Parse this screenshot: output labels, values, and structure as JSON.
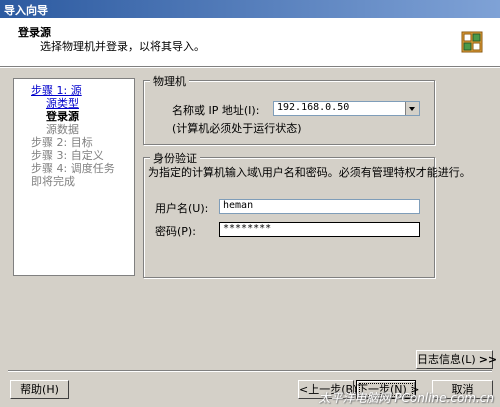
{
  "window": {
    "title": "导入向导"
  },
  "header": {
    "title": "登录源",
    "subtitle": "选择物理机并登录，以将其导入。",
    "icon": "wizard-icon"
  },
  "nav": {
    "step1": "步骤 1: 源",
    "step1_sub1": "源类型",
    "step1_sub2": "登录源",
    "step1_sub3": "源数据",
    "step2": "步骤 2: 目标",
    "step3": "步骤 3: 自定义",
    "step4": "步骤 4: 调度任务",
    "finish": "即将完成"
  },
  "physical": {
    "legend": "物理机",
    "name_label": "名称或 IP 地址(I):",
    "name_value": "192.168.0.50",
    "hint": "(计算机必须处于运行状态)"
  },
  "auth": {
    "legend": "身份验证",
    "desc": "为指定的计算机输入域\\用户名和密码。必须有管理特权才能进行。",
    "user_label": "用户名(U):",
    "user_value": "heman",
    "pass_label": "密码(P):",
    "pass_value": "********"
  },
  "buttons": {
    "log": "日志信息(L)",
    "log_arrow": ">>",
    "help": "帮助(H)",
    "back": "<上一步(B)",
    "next": "下一步(N) >",
    "cancel": "取消"
  },
  "watermark": "太平洋电脑网 PConline.com.cn",
  "colors": {
    "titlebar": "#2c5aa0",
    "link": "#0000cc",
    "dialog": "#d4d0c8"
  }
}
